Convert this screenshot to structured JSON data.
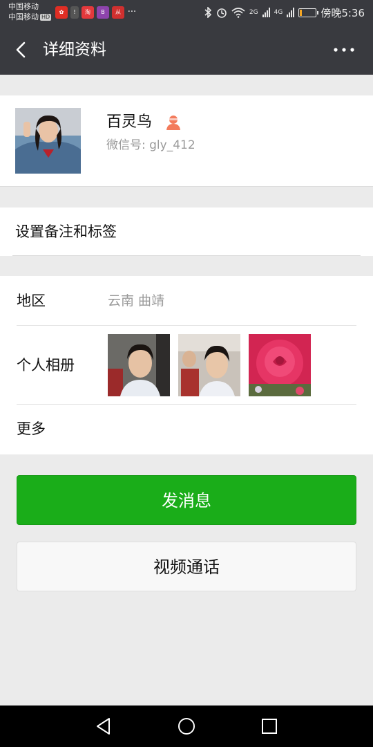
{
  "status_bar": {
    "carrier_1": "中国移动",
    "carrier_2": "中国移动",
    "hd_badge": "HD",
    "app_icons": [
      "pinduoduo-icon",
      "alert-icon",
      "taobao-icon",
      "bank-icon",
      "xiaomi-shop-icon",
      "more-dots-icon"
    ],
    "network_1": "2G",
    "network_2": "4G",
    "time": "傍晚5:36",
    "battery_level": 0.15,
    "battery_color": "#f5a623"
  },
  "navbar": {
    "title": "详细资料",
    "back_icon": "back-arrow-icon",
    "more_icon": "more-dots-icon",
    "background": "#393a3f"
  },
  "profile": {
    "name": "百灵鸟",
    "wechat_id": "微信号: gly_412",
    "gender_icon": "female-icon",
    "gender_color": "#f37b5c"
  },
  "remark": {
    "label": "设置备注和标签"
  },
  "info": {
    "region_label": "地区",
    "region_value": "云南  曲靖",
    "album_label": "个人相册",
    "more_label": "更多"
  },
  "buttons": {
    "send_message": "发消息",
    "video_call": "视频通话",
    "accent": "#1aad19"
  }
}
